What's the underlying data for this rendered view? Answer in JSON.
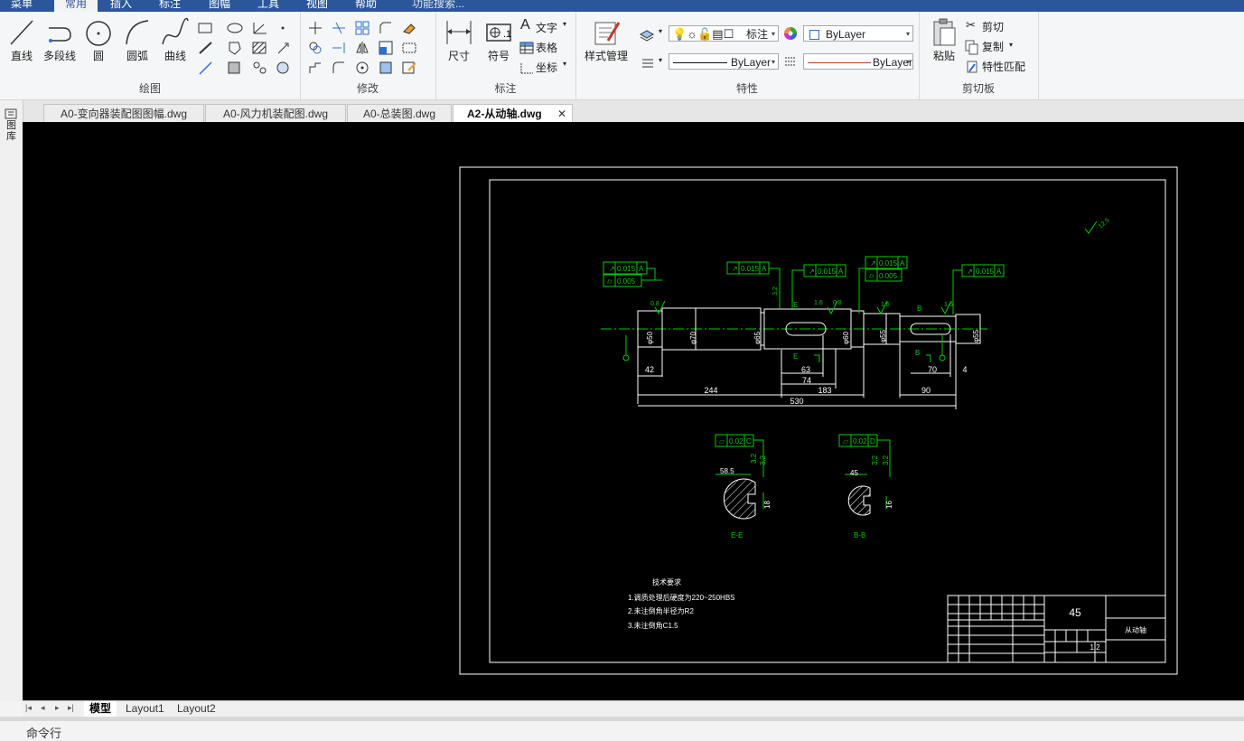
{
  "menu": {
    "items": [
      "菜单",
      "常用",
      "插入",
      "标注",
      "图幅",
      "工具",
      "视图",
      "帮助"
    ],
    "active": "常用",
    "search_placeholder": "功能搜索..."
  },
  "ribbon": {
    "draw": {
      "label": "绘图",
      "line": "直线",
      "polyline": "多段线",
      "circle": "圆",
      "arc": "圆弧",
      "curve": "曲线"
    },
    "modify": {
      "label": "修改"
    },
    "annotate": {
      "label": "标注",
      "dimension": "尺寸",
      "symbol": "符号",
      "text": "文字",
      "table": "表格",
      "coord": "坐标"
    },
    "properties": {
      "label": "特性",
      "style_manager": "样式管理",
      "layer_name": "标注",
      "color_value": "ByLayer",
      "linetype_value": "ByLayer",
      "lineweight_value": "ByLayer"
    },
    "clipboard": {
      "label": "剪切板",
      "paste": "粘贴",
      "cut": "剪切",
      "copy": "复制",
      "match": "特性匹配"
    }
  },
  "doc_tabs": [
    {
      "label": "A0-变向器装配图图幅.dwg",
      "active": false
    },
    {
      "label": "A0-风力机装配图.dwg",
      "active": false
    },
    {
      "label": "A0-总装图.dwg",
      "active": false
    },
    {
      "label": "A2-从动轴.dwg",
      "active": true
    }
  ],
  "left_palette": {
    "label": "图库"
  },
  "drawing": {
    "roughness_corner": "12.5",
    "dims": {
      "d42": "42",
      "d244": "244",
      "d530": "530",
      "d63": "63",
      "d74": "74",
      "d183": "183",
      "d90": "90",
      "d70": "70",
      "d4": "4",
      "phi50": "φ50",
      "phi70": "φ70",
      "phi65": "φ65",
      "phi60": "φ60",
      "phi55": "φ55",
      "phi55b": "φ55"
    },
    "tolerances": {
      "t1": "0.015",
      "t1d": "A",
      "t2": "0.005",
      "t3": "0.015",
      "t3d": "A",
      "t4": "0.015",
      "t4d": "A",
      "t5": "0.015",
      "t5d": "A",
      "t6": "0.005",
      "t7": "0.015",
      "t7d": "A",
      "t8": "0.02",
      "t8d": "C",
      "t9": "0.02",
      "t9d": "D"
    },
    "roughness": [
      "0.8",
      "3.2",
      "1.6",
      "0.8",
      "1.6",
      "1.6",
      "3.2",
      "3.2",
      "3.2",
      "3.2"
    ],
    "section_labels": {
      "ee": "E-E",
      "bb": "B-B",
      "e_mark": "E",
      "b_mark": "B",
      "e_mark2": "E",
      "b_mark2": "B"
    },
    "section_dims": {
      "s1": "58.5",
      "s2": "18",
      "s3": "45",
      "s4": "16"
    },
    "notes": {
      "title": "技术要求",
      "l1": "1.调质处理后硬度为220~250HBS",
      "l2": "2.未注倒角半径为R2",
      "l3": "3.未注倒角C1.5"
    },
    "title_block": {
      "material": "45",
      "name": "从动轴",
      "scale": "1:2"
    }
  },
  "layout_tabs": [
    {
      "label": "模型",
      "active": true
    },
    {
      "label": "Layout1",
      "active": false
    },
    {
      "label": "Layout2",
      "active": false
    }
  ],
  "command": {
    "label": "命令行"
  }
}
